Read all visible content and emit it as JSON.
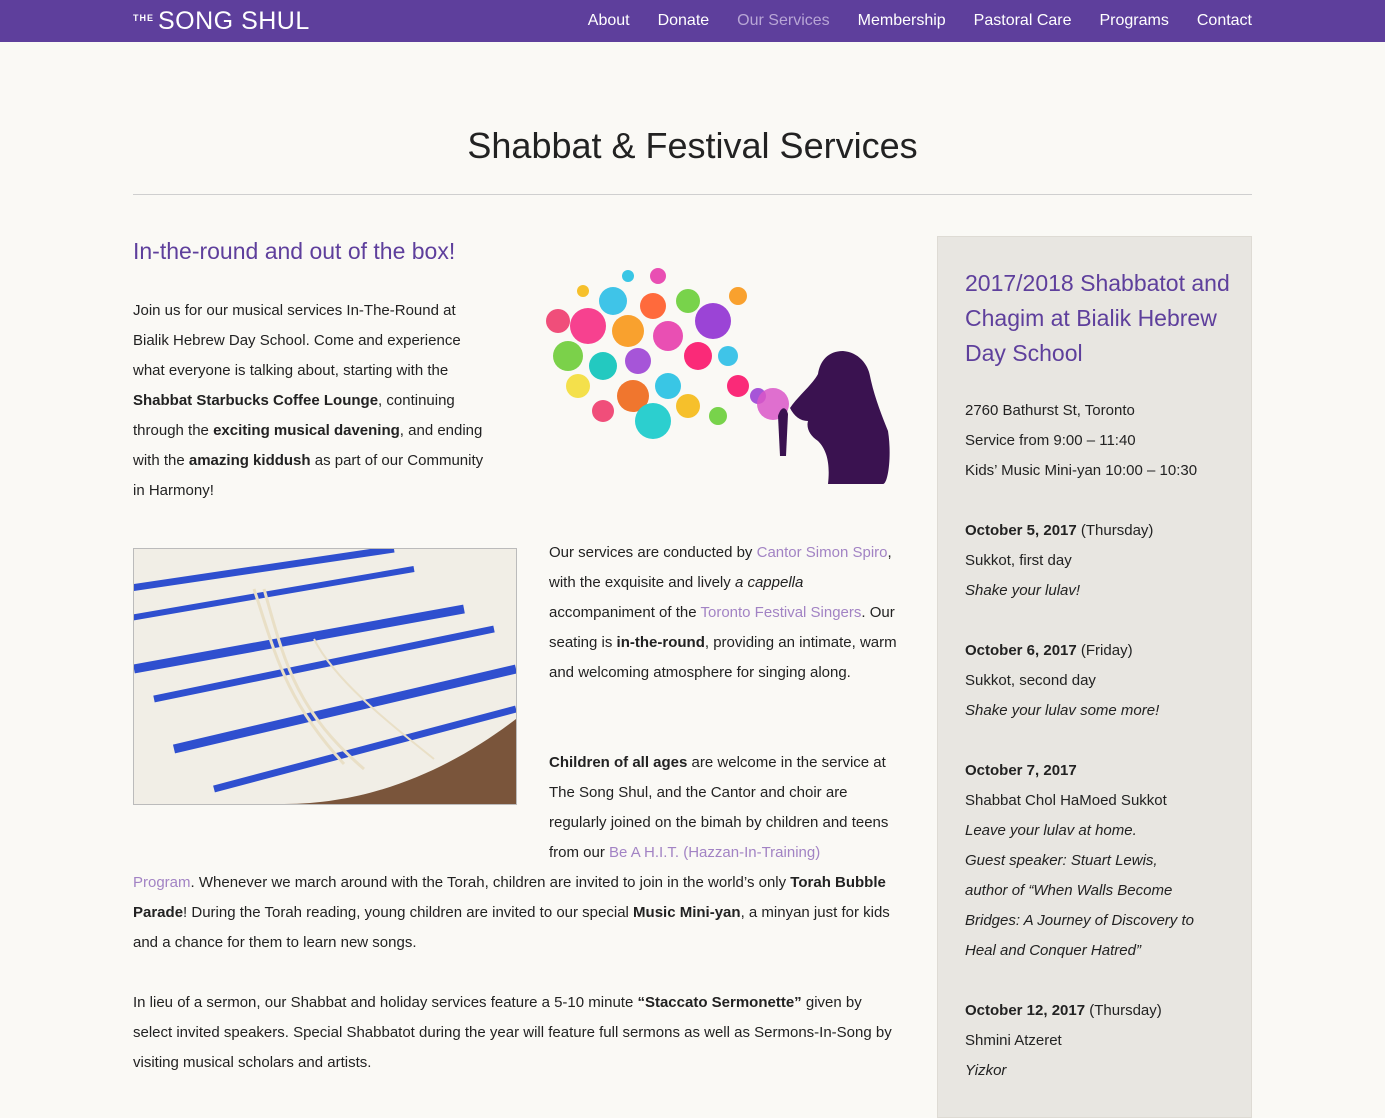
{
  "header": {
    "logo_the": "THE",
    "logo_name": "SONG SHUL",
    "nav": [
      "About",
      "Donate",
      "Our Services",
      "Membership",
      "Pastoral Care",
      "Programs",
      "Contact"
    ],
    "active_nav": "Our Services"
  },
  "page": {
    "title": "Shabbat & Festival Services",
    "subhead": "In-the-round and out of the box!"
  },
  "intro": {
    "t1": "Join us for our musical services In-The-Round at Bialik Hebrew Day School. Come and experience what everyone is talking about, starting with the ",
    "b1": "Shabbat Starbucks Coffee Lounge",
    "t2": ", continuing through the ",
    "b2": "exciting musical davening",
    "t3": ", and ending with the ",
    "b3": "amazing kiddush",
    "t4": " as part of our Community in Harmony!"
  },
  "services": {
    "t1": "Our services are conducted by ",
    "link1": "Cantor Simon Spiro",
    "t2": ", with the exquisite and lively ",
    "i1": "a cappella",
    "t3": " accompaniment of the ",
    "link2": "Toronto Festival Singers",
    "t4": ". Our seating is ",
    "b1": "in-the-round",
    "t5": ", providing an intimate, warm and welcoming atmosphere for singing along."
  },
  "children": {
    "b1": "Children of all ages",
    "t1": " are welcome in the service at The Song Shul, and the Cantor and choir are regularly joined on the bimah by children and teens from our ",
    "link1a": "Be A H.I.T. (Hazzan-In-Training)",
    "link1b": "Program",
    "t2": ". Whenever we march around with the Torah, children are invited to join in the world’s only ",
    "b2": "Torah Bubble Parade",
    "t3": "! During the Torah reading, young children are invited to our special ",
    "b3": "Music Mini-yan",
    "t4": ", a minyan just for kids and a chance for them to learn new songs."
  },
  "sermon": {
    "t1": "In lieu of a sermon, our Shabbat and holiday services feature a 5-10 minute ",
    "b1": "“Staccato Sermonette”",
    "t2": " given by select invited speakers. Special Shabbatot during the year will feature full sermons as well as Sermons-In-Song by visiting musical scholars and artists."
  },
  "sidebar": {
    "title": "2017/2018 Shabbatot and Chagim at Bialik Hebrew Day School",
    "address": "2760 Bathurst St, Toronto",
    "service_time": "Service from 9:00 – 11:40",
    "kids_time": "Kids’ Music Mini-yan 10:00 – 10:30",
    "events": [
      {
        "date": "October 5, 2017",
        "day": " (Thursday)",
        "name": "Sukkot, first day",
        "notes": [
          "Shake your lulav!"
        ]
      },
      {
        "date": "October 6, 2017",
        "day": " (Friday)",
        "name": "Sukkot, second day",
        "notes": [
          "Shake your lulav some more!"
        ]
      },
      {
        "date": "October 7, 2017",
        "day": "",
        "name": "Shabbat Chol HaMoed Sukkot",
        "notes": [
          "Leave your lulav at home.",
          "Guest speaker: Stuart Lewis,",
          "author of “When Walls Become",
          "Bridges: A Journey of Discovery to",
          "Heal and Conquer Hatred”"
        ]
      },
      {
        "date": "October 12, 2017",
        "day": " (Thursday)",
        "name": "Shmini Atzeret",
        "notes": [
          "Yizkor"
        ]
      }
    ]
  },
  "colors": {
    "brand_purple": "#5e3f9c",
    "link_purple": "#a283c4",
    "nav_active": "#b8a6d6",
    "sidebar_bg": "#e8e6e1"
  }
}
